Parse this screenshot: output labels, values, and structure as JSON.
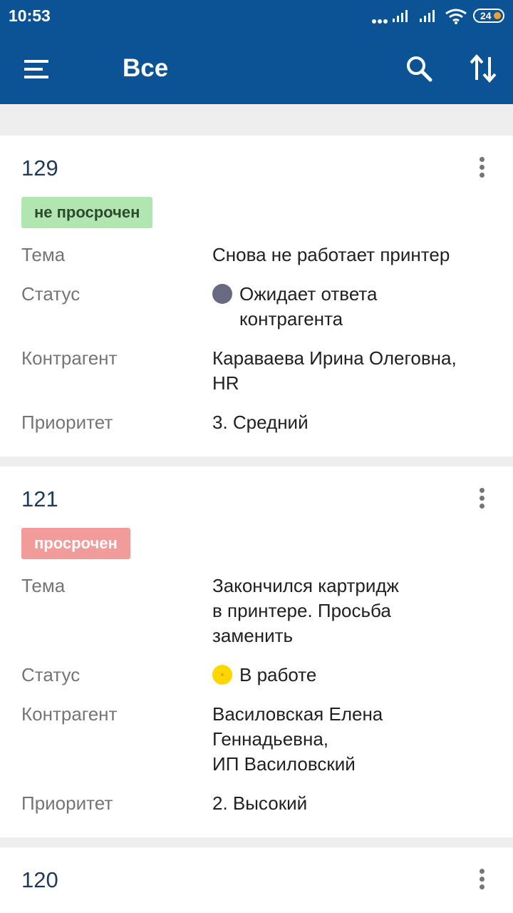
{
  "status_bar": {
    "time": "10:53",
    "battery": "24"
  },
  "appbar": {
    "title": "Все"
  },
  "colors": {
    "primary": "#0b5394",
    "badge_ok": "#b2e6b0",
    "badge_late": "#f19b9b",
    "status_waiting": "#676a80",
    "status_in_work": "#ffd600"
  },
  "labels": {
    "topic": "Тема",
    "status": "Статус",
    "counterparty": "Контрагент",
    "priority": "Приоритет"
  },
  "tickets": [
    {
      "number": "129",
      "badge": "не просрочен",
      "topic": "Снова не работает принтер",
      "status": "Ожидает ответа\nконтрагента",
      "counterparty": "Караваева Ирина Олеговна,\nHR",
      "priority": "3. Средний"
    },
    {
      "number": "121",
      "badge": "просрочен",
      "topic": "Закончился картридж\nв принтере. Просьба\nзаменить",
      "status": "В работе",
      "counterparty": "Василовская Елена\nГеннадьевна,\nИП Василовский",
      "priority": "2. Высокий"
    },
    {
      "number": "120"
    }
  ]
}
